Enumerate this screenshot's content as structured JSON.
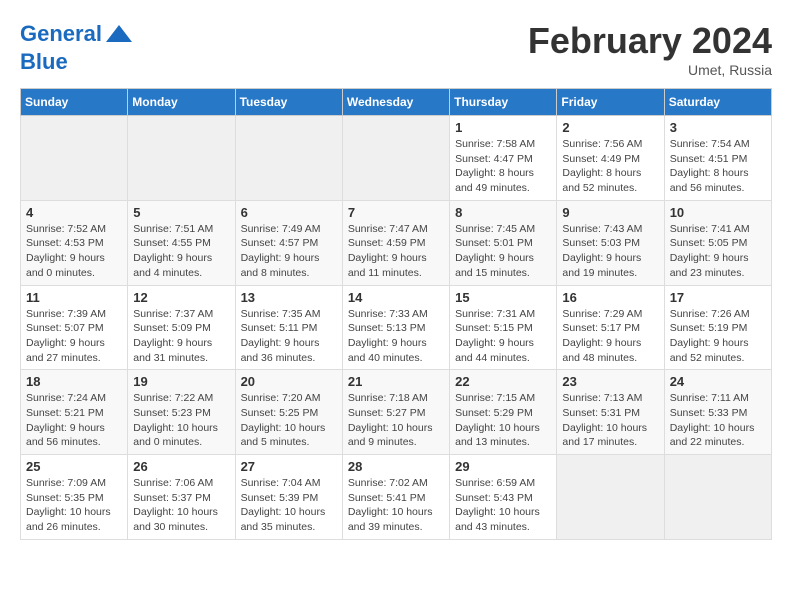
{
  "logo": {
    "line1": "General",
    "line2": "Blue"
  },
  "title": "February 2024",
  "subtitle": "Umet, Russia",
  "days_header": [
    "Sunday",
    "Monday",
    "Tuesday",
    "Wednesday",
    "Thursday",
    "Friday",
    "Saturday"
  ],
  "weeks": [
    [
      {
        "day": "",
        "info": ""
      },
      {
        "day": "",
        "info": ""
      },
      {
        "day": "",
        "info": ""
      },
      {
        "day": "",
        "info": ""
      },
      {
        "day": "1",
        "info": "Sunrise: 7:58 AM\nSunset: 4:47 PM\nDaylight: 8 hours\nand 49 minutes."
      },
      {
        "day": "2",
        "info": "Sunrise: 7:56 AM\nSunset: 4:49 PM\nDaylight: 8 hours\nand 52 minutes."
      },
      {
        "day": "3",
        "info": "Sunrise: 7:54 AM\nSunset: 4:51 PM\nDaylight: 8 hours\nand 56 minutes."
      }
    ],
    [
      {
        "day": "4",
        "info": "Sunrise: 7:52 AM\nSunset: 4:53 PM\nDaylight: 9 hours\nand 0 minutes."
      },
      {
        "day": "5",
        "info": "Sunrise: 7:51 AM\nSunset: 4:55 PM\nDaylight: 9 hours\nand 4 minutes."
      },
      {
        "day": "6",
        "info": "Sunrise: 7:49 AM\nSunset: 4:57 PM\nDaylight: 9 hours\nand 8 minutes."
      },
      {
        "day": "7",
        "info": "Sunrise: 7:47 AM\nSunset: 4:59 PM\nDaylight: 9 hours\nand 11 minutes."
      },
      {
        "day": "8",
        "info": "Sunrise: 7:45 AM\nSunset: 5:01 PM\nDaylight: 9 hours\nand 15 minutes."
      },
      {
        "day": "9",
        "info": "Sunrise: 7:43 AM\nSunset: 5:03 PM\nDaylight: 9 hours\nand 19 minutes."
      },
      {
        "day": "10",
        "info": "Sunrise: 7:41 AM\nSunset: 5:05 PM\nDaylight: 9 hours\nand 23 minutes."
      }
    ],
    [
      {
        "day": "11",
        "info": "Sunrise: 7:39 AM\nSunset: 5:07 PM\nDaylight: 9 hours\nand 27 minutes."
      },
      {
        "day": "12",
        "info": "Sunrise: 7:37 AM\nSunset: 5:09 PM\nDaylight: 9 hours\nand 31 minutes."
      },
      {
        "day": "13",
        "info": "Sunrise: 7:35 AM\nSunset: 5:11 PM\nDaylight: 9 hours\nand 36 minutes."
      },
      {
        "day": "14",
        "info": "Sunrise: 7:33 AM\nSunset: 5:13 PM\nDaylight: 9 hours\nand 40 minutes."
      },
      {
        "day": "15",
        "info": "Sunrise: 7:31 AM\nSunset: 5:15 PM\nDaylight: 9 hours\nand 44 minutes."
      },
      {
        "day": "16",
        "info": "Sunrise: 7:29 AM\nSunset: 5:17 PM\nDaylight: 9 hours\nand 48 minutes."
      },
      {
        "day": "17",
        "info": "Sunrise: 7:26 AM\nSunset: 5:19 PM\nDaylight: 9 hours\nand 52 minutes."
      }
    ],
    [
      {
        "day": "18",
        "info": "Sunrise: 7:24 AM\nSunset: 5:21 PM\nDaylight: 9 hours\nand 56 minutes."
      },
      {
        "day": "19",
        "info": "Sunrise: 7:22 AM\nSunset: 5:23 PM\nDaylight: 10 hours\nand 0 minutes."
      },
      {
        "day": "20",
        "info": "Sunrise: 7:20 AM\nSunset: 5:25 PM\nDaylight: 10 hours\nand 5 minutes."
      },
      {
        "day": "21",
        "info": "Sunrise: 7:18 AM\nSunset: 5:27 PM\nDaylight: 10 hours\nand 9 minutes."
      },
      {
        "day": "22",
        "info": "Sunrise: 7:15 AM\nSunset: 5:29 PM\nDaylight: 10 hours\nand 13 minutes."
      },
      {
        "day": "23",
        "info": "Sunrise: 7:13 AM\nSunset: 5:31 PM\nDaylight: 10 hours\nand 17 minutes."
      },
      {
        "day": "24",
        "info": "Sunrise: 7:11 AM\nSunset: 5:33 PM\nDaylight: 10 hours\nand 22 minutes."
      }
    ],
    [
      {
        "day": "25",
        "info": "Sunrise: 7:09 AM\nSunset: 5:35 PM\nDaylight: 10 hours\nand 26 minutes."
      },
      {
        "day": "26",
        "info": "Sunrise: 7:06 AM\nSunset: 5:37 PM\nDaylight: 10 hours\nand 30 minutes."
      },
      {
        "day": "27",
        "info": "Sunrise: 7:04 AM\nSunset: 5:39 PM\nDaylight: 10 hours\nand 35 minutes."
      },
      {
        "day": "28",
        "info": "Sunrise: 7:02 AM\nSunset: 5:41 PM\nDaylight: 10 hours\nand 39 minutes."
      },
      {
        "day": "29",
        "info": "Sunrise: 6:59 AM\nSunset: 5:43 PM\nDaylight: 10 hours\nand 43 minutes."
      },
      {
        "day": "",
        "info": ""
      },
      {
        "day": "",
        "info": ""
      }
    ]
  ]
}
